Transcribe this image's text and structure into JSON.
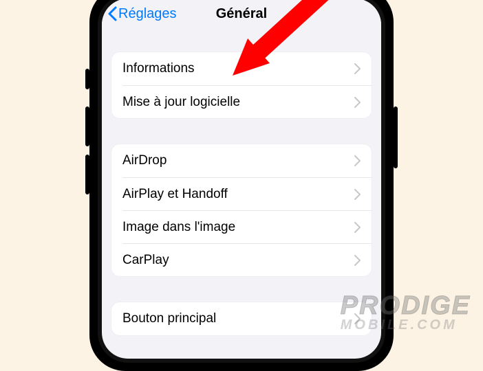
{
  "nav": {
    "back_label": "Réglages",
    "title": "Général"
  },
  "group1": {
    "rows": [
      {
        "label": "Informations"
      },
      {
        "label": "Mise à jour logicielle"
      }
    ]
  },
  "group2": {
    "rows": [
      {
        "label": "AirDrop"
      },
      {
        "label": "AirPlay et Handoff"
      },
      {
        "label": "Image dans l'image"
      },
      {
        "label": "CarPlay"
      }
    ]
  },
  "group3": {
    "rows": [
      {
        "label": "Bouton principal"
      }
    ]
  },
  "watermark": {
    "top": "PRODIGE",
    "bottom": "MOBILE.COM"
  }
}
